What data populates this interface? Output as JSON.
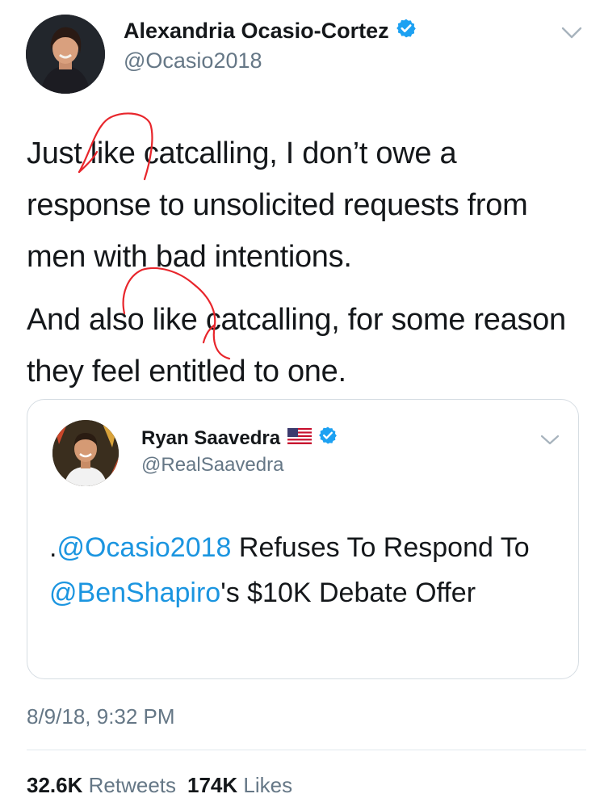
{
  "tweet": {
    "author_name": "Alexandria Ocasio-Cortez",
    "author_handle": "@Ocasio2018",
    "paragraph1": "Just like catcalling, I don’t owe a response to unsolicited requests from men with bad intentions.",
    "paragraph2": "And also like catcalling, for some reason they feel entitled to one.",
    "timestamp": "8/9/18, 9:32 PM"
  },
  "quoted": {
    "author_name": "Ryan Saavedra",
    "author_handle": "@RealSaavedra",
    "text_prefix": ".",
    "mention1": "@Ocasio2018",
    "text_mid": " Refuses To Respond To ",
    "mention2": "@BenShapiro",
    "text_suffix": "'s $10K Debate Offer"
  },
  "stats": {
    "retweets_count": "32.6K",
    "retweets_label": "Retweets",
    "likes_count": "174K",
    "likes_label": "Likes"
  },
  "colors": {
    "link": "#1b95e0",
    "verified": "#1da1f2",
    "secondary_text": "#657786",
    "annotation": "#e8262c"
  },
  "icons": {
    "verified": "verified-badge-icon",
    "menu": "chevron-down-icon",
    "flag": "us-flag-icon"
  }
}
